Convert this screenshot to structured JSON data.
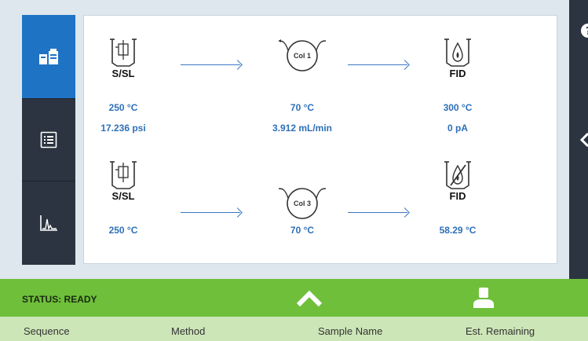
{
  "sidebar": {
    "items": [
      {
        "name": "instrument-view",
        "icon": "instrument-icon",
        "active": true
      },
      {
        "name": "sequence-list",
        "icon": "list-icon",
        "active": false
      },
      {
        "name": "chromatogram",
        "icon": "chromatogram-icon",
        "active": false
      }
    ]
  },
  "flow": {
    "row1": {
      "inlet": {
        "name": "S/SL",
        "temp": "250 °C",
        "pressure": "17.236 psi"
      },
      "column": {
        "label": "Col 1",
        "temp": "70 °C",
        "flow": "3.912 mL/min"
      },
      "detector": {
        "name": "FID",
        "temp": "300 °C",
        "signal": "0 pA"
      }
    },
    "row2": {
      "inlet": {
        "name": "S/SL",
        "temp": "250 °C"
      },
      "column": {
        "label": "Col 3",
        "temp": "70 °C"
      },
      "detector": {
        "name": "FID",
        "temp": "58.29 °C"
      }
    }
  },
  "status": {
    "text": "STATUS: READY",
    "color": "#6fbf3b"
  },
  "table_header": {
    "columns": [
      "Sequence",
      "Method",
      "Sample Name",
      "Est. Remaining"
    ]
  },
  "colors": {
    "accent": "#1f73c4",
    "value_blue": "#2e6fb8",
    "status_green": "#6fbf3b",
    "sidebar_dark": "#2b3440"
  }
}
